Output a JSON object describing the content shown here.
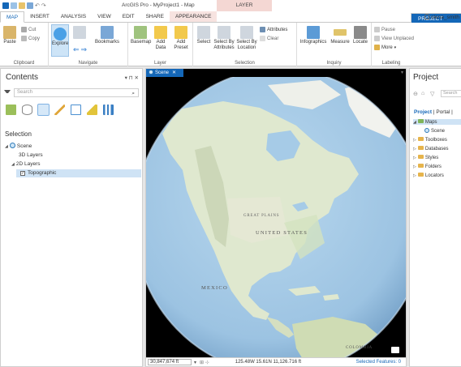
{
  "window": {
    "title": "ArcGIS Pro - MyProject1 - Map",
    "contextual_header": "LAYER",
    "user": "olena_smith"
  },
  "ribbon_tabs": [
    {
      "label": "PROJECT"
    },
    {
      "label": "MAP"
    },
    {
      "label": "INSERT"
    },
    {
      "label": "ANALYSIS"
    },
    {
      "label": "VIEW"
    },
    {
      "label": "EDIT"
    },
    {
      "label": "SHARE"
    },
    {
      "label": "APPEARANCE"
    }
  ],
  "ribbon": {
    "clipboard": {
      "label": "Clipboard",
      "paste": "Paste",
      "cut": "Cut",
      "copy": "Copy"
    },
    "navigate": {
      "label": "Navigate",
      "explore": "Explore",
      "bookmarks": "Bookmarks"
    },
    "layer": {
      "label": "Layer",
      "basemap": "Basemap",
      "add_data": "Add",
      "add_data2": "Data",
      "add_preset": "Add",
      "add_preset2": "Preset"
    },
    "selection": {
      "label": "Selection",
      "select": "Select",
      "select_by_attr": "Select By",
      "select_by_attr2": "Attributes",
      "select_by_loc": "Select By",
      "select_by_loc2": "Location",
      "attributes": "Attributes",
      "clear": "Clear"
    },
    "inquiry": {
      "label": "Inquiry",
      "infographics": "Infographics",
      "measure": "Measure",
      "locate": "Locate"
    },
    "labeling": {
      "label": "Labeling",
      "pause": "Pause",
      "view_unplaced": "View Unplaced",
      "more": "More"
    }
  },
  "contents": {
    "title": "Contents",
    "controls": "▾ ⊓ ✕",
    "search_placeholder": "Search",
    "section_title": "Selection",
    "tree": [
      {
        "label": "Scene"
      },
      {
        "label": "3D Layers"
      },
      {
        "label": "2D Layers"
      },
      {
        "label": "Topographic"
      }
    ]
  },
  "scene": {
    "tab_label": "Scene",
    "labels": {
      "united_states": "UNITED STATES",
      "great_plains": "GREAT PLAINS",
      "mexico": "MEXICO",
      "colombia": "COLOMBIA"
    },
    "status": {
      "scale": "30,847,674 ft",
      "coordinates": "125.48W 15.61N  11,126.716 ft",
      "selected_features": "Selected Features: 0"
    }
  },
  "project": {
    "title": "Project",
    "search_placeholder": "Search",
    "tab_project": "Project",
    "tab_portal": "Portal",
    "items": [
      {
        "label": "Maps"
      },
      {
        "label": "Scene"
      },
      {
        "label": "Toolboxes"
      },
      {
        "label": "Databases"
      },
      {
        "label": "Styles"
      },
      {
        "label": "Folders"
      },
      {
        "label": "Locators"
      }
    ]
  },
  "colors": {
    "accent": "#1467b8",
    "ocean": "#a9cde8",
    "land": "#dfe8cf",
    "context_tab": "#f7e3e0"
  }
}
